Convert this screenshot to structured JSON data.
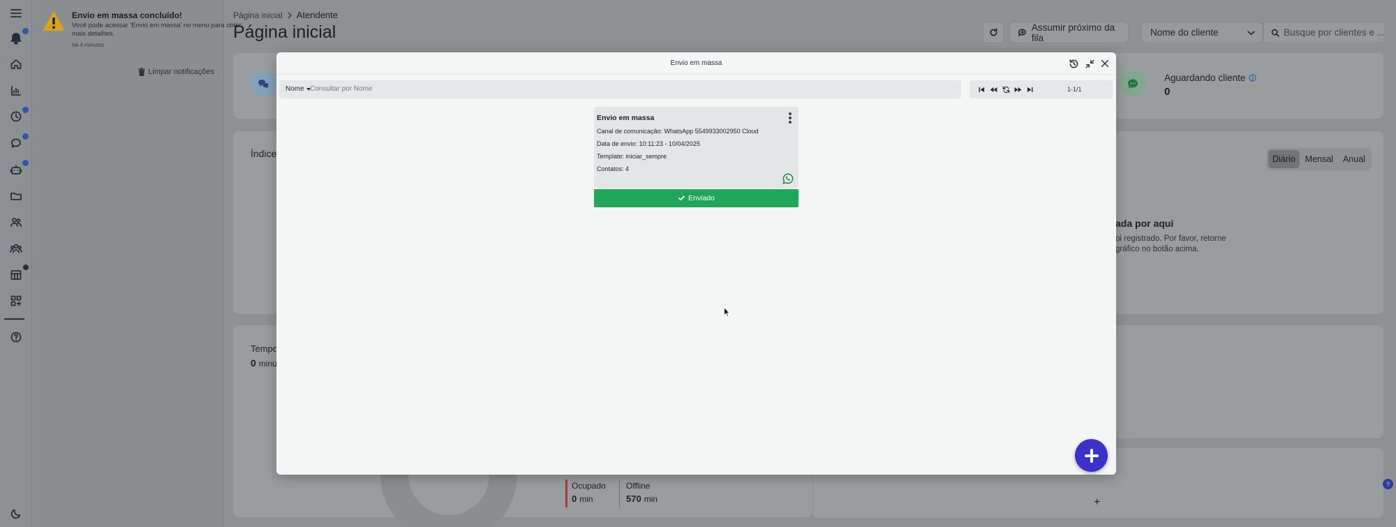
{
  "notification": {
    "title": "Envio em massa concluído!",
    "body": "Você pode acessar 'Envio em massa' no menu para obter mais detalhes.",
    "time": "há 4 minutos",
    "clear_label": "Limpar notificações"
  },
  "header": {
    "breadcrumb_home": "Página inicial",
    "breadcrumb_current": "Atendente",
    "page_title": "Página inicial",
    "next_in_queue_label": "Assumir próximo da fila",
    "client_select_value": "Nome do cliente",
    "search_placeholder": "Busque por clientes e ..."
  },
  "background": {
    "waiting_label": "Aguardando cliente",
    "waiting_value": "0",
    "card_title_partial": "Índice",
    "period_tabs": [
      "Diário",
      "Mensal",
      "Anual"
    ],
    "period_selected": "Diário",
    "empty_title_partial": "ada por aqui",
    "empty_line1": "oi registrado. Por favor, retorne",
    "empty_line2": "gráfico no botão acima.",
    "time_label_partial": "Tempo",
    "time_value": "0",
    "time_unit_partial": "minu",
    "busy_label": "Ocupado",
    "busy_value": "0",
    "busy_unit": "min",
    "offline_label": "Offline",
    "offline_value": "570",
    "offline_unit": "min",
    "plus": "+",
    "help": "?"
  },
  "modal": {
    "title": "Envio em massa",
    "filter_field": "Nome",
    "filter_placeholder": "Consultar por Nome",
    "pager_count": "1-1/1",
    "item": {
      "title": "Envio em massa",
      "channel": "Canal de comunicação: WhatsApp 5549933002950 Cloud",
      "sent_date": "Data de envio: 10:11:23 - 10/04/2025",
      "template": "Template: iniciar_sempre",
      "contacts": "Contatos: 4",
      "status": "Enviado"
    }
  },
  "icons": {
    "rail": [
      "menu-icon",
      "bell-icon",
      "home-icon",
      "chart-icon",
      "clock-icon",
      "chat-icon",
      "bot-icon",
      "folder-icon",
      "users-icon",
      "groups-icon",
      "reports-icon",
      "apps-icon",
      "help-icon",
      "moon-icon"
    ],
    "warning": "warning-icon",
    "whatsapp": "whatsapp-icon"
  },
  "colors": {
    "accent": "#3d32c7",
    "sent_green": "#1fa65a",
    "badge_blue": "#2f56a8",
    "warning_yellow": "#d9a21b",
    "whatsapp_green": "#1f7a3e"
  }
}
